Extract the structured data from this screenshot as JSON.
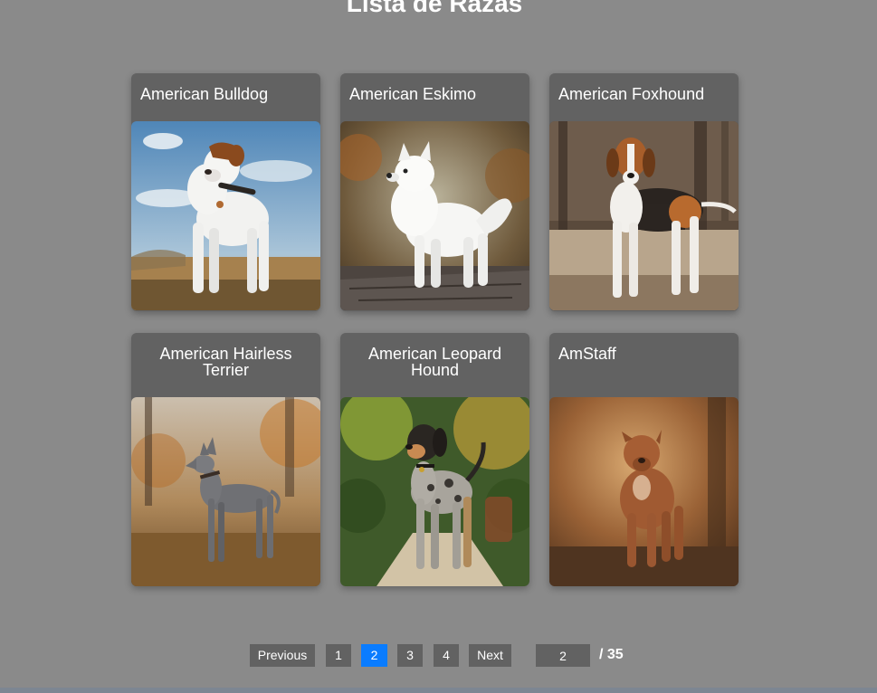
{
  "page": {
    "title": "Lista de Razas"
  },
  "breeds": [
    {
      "name": "American Bulldog",
      "image": "white-bulldog-photo"
    },
    {
      "name": "American Eskimo",
      "image": "white-spitz-photo"
    },
    {
      "name": "American Foxhound",
      "image": "tricolor-foxhound-photo"
    },
    {
      "name": "American Hairless Terrier",
      "image": "gray-hairless-terrier-photo"
    },
    {
      "name": "American Leopard Hound",
      "image": "merle-leopard-hound-photo"
    },
    {
      "name": "AmStaff",
      "image": "red-amstaff-photo"
    }
  ],
  "pagination": {
    "previous_label": "Previous",
    "next_label": "Next",
    "pages": [
      "1",
      "2",
      "3",
      "4"
    ],
    "current_page": "2",
    "page_input_value": "2",
    "total_label": "/ 35"
  },
  "colors": {
    "background": "#8a8a8a",
    "card": "#626262",
    "active_page": "#0a7cff",
    "text": "#ffffff"
  }
}
